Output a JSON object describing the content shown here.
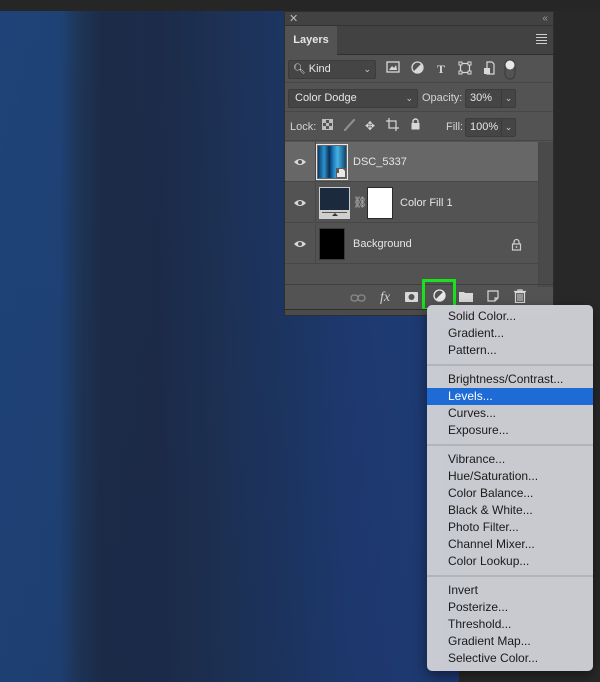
{
  "panel": {
    "tab_label": "Layers",
    "close_icon": "close-icon",
    "collapse_icon": "double-chevron-left-icon",
    "menu_icon": "hamburger-menu-icon",
    "filter": {
      "kind_label": "Kind",
      "filter_icons": [
        "pixel-layer-filter-icon",
        "adjustment-layer-filter-icon",
        "type-layer-filter-icon",
        "shape-layer-filter-icon",
        "smart-object-filter-icon",
        "filter-toggle-switch"
      ]
    },
    "blend": {
      "mode": "Color Dodge",
      "opacity_label": "Opacity:",
      "opacity_value": "30%"
    },
    "lock": {
      "label": "Lock:",
      "icons": [
        "lock-transparent-pixels-icon",
        "lock-image-pixels-icon",
        "lock-position-icon",
        "lock-artboard-icon",
        "lock-all-icon"
      ],
      "fill_label": "Fill:",
      "fill_value": "100%"
    },
    "layers": [
      {
        "name": "DSC_5337",
        "selected": true,
        "visible": true,
        "type": "smart-object"
      },
      {
        "name": "Color Fill 1",
        "selected": false,
        "visible": true,
        "type": "fill"
      },
      {
        "name": "Background",
        "selected": false,
        "visible": true,
        "type": "background",
        "locked": true
      }
    ],
    "bottom_icons": [
      "link-layers-icon",
      "fx-icon",
      "add-mask-icon",
      "new-adjustment-layer-icon",
      "new-group-icon",
      "new-layer-icon",
      "delete-layer-icon"
    ]
  },
  "menu": {
    "groups": [
      [
        "Solid Color...",
        "Gradient...",
        "Pattern..."
      ],
      [
        "Brightness/Contrast...",
        "Levels...",
        "Curves...",
        "Exposure..."
      ],
      [
        "Vibrance...",
        "Hue/Saturation...",
        "Color Balance...",
        "Black & White...",
        "Photo Filter...",
        "Channel Mixer...",
        "Color Lookup..."
      ],
      [
        "Invert",
        "Posterize...",
        "Threshold...",
        "Gradient Map...",
        "Selective Color..."
      ]
    ],
    "active_item": "Levels...",
    "active_color": "#1e6bd6"
  },
  "colors": {
    "highlight_box": "#19e11d",
    "panel_bg": "#535353",
    "selected_layer_bg": "#676767"
  }
}
